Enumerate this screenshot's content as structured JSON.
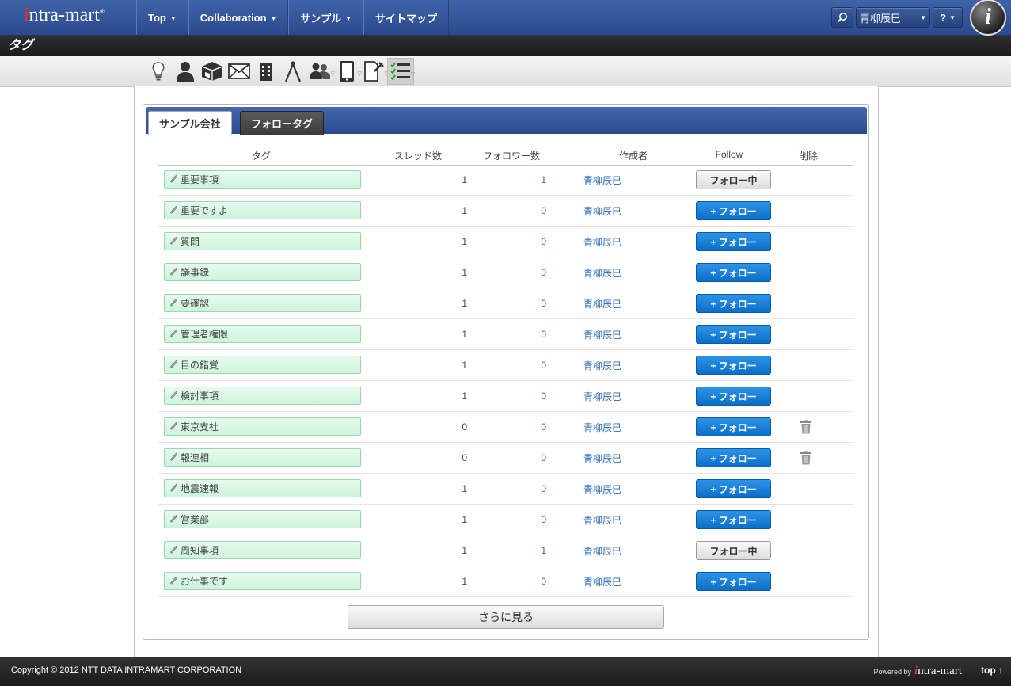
{
  "header": {
    "logo_i": "i",
    "logo_rest": "ntra-mart",
    "nav": [
      {
        "label": "Top",
        "caret": "▼"
      },
      {
        "label": "Collaboration",
        "caret": "▼"
      },
      {
        "label": "サンプル",
        "caret": "▼"
      },
      {
        "label": "サイトマップ",
        "caret": ""
      }
    ],
    "user_name": "青柳辰巳",
    "user_caret": "▼",
    "help_label": "?",
    "help_caret": "▼",
    "avatar_letter": "i"
  },
  "page_title": "タグ",
  "toolbar_icons": [
    "lightbulb-icon",
    "person-icon",
    "cube-icon",
    "mail-icon",
    "building-icon",
    "compass-icon",
    "group-icon",
    "tablet-icon",
    "document-pin-icon",
    "checklist-icon"
  ],
  "tabs": [
    {
      "label": "サンプル会社",
      "active": true
    },
    {
      "label": "フォロータグ",
      "active": false
    }
  ],
  "table": {
    "headers": {
      "tag": "タグ",
      "threads": "スレッド数",
      "followers": "フォロワー数",
      "creator": "作成者",
      "follow": "Follow",
      "delete": "削除"
    },
    "rows": [
      {
        "tag": "重要事項",
        "threads": "1",
        "followers": "1",
        "creator": "青柳辰巳",
        "follow": "フォロー中",
        "following": true,
        "deletable": false
      },
      {
        "tag": "重要ですよ",
        "threads": "1",
        "followers": "0",
        "creator": "青柳辰巳",
        "follow": "+ フォロー",
        "following": false,
        "deletable": false
      },
      {
        "tag": "質問",
        "threads": "1",
        "followers": "0",
        "creator": "青柳辰巳",
        "follow": "+ フォロー",
        "following": false,
        "deletable": false
      },
      {
        "tag": "議事録",
        "threads": "1",
        "followers": "0",
        "creator": "青柳辰巳",
        "follow": "+ フォロー",
        "following": false,
        "deletable": false
      },
      {
        "tag": "要確認",
        "threads": "1",
        "followers": "0",
        "creator": "青柳辰巳",
        "follow": "+ フォロー",
        "following": false,
        "deletable": false
      },
      {
        "tag": "管理者権限",
        "threads": "1",
        "followers": "0",
        "creator": "青柳辰巳",
        "follow": "+ フォロー",
        "following": false,
        "deletable": false
      },
      {
        "tag": "目の錯覚",
        "threads": "1",
        "followers": "0",
        "creator": "青柳辰巳",
        "follow": "+ フォロー",
        "following": false,
        "deletable": false
      },
      {
        "tag": "検討事項",
        "threads": "1",
        "followers": "0",
        "creator": "青柳辰巳",
        "follow": "+ フォロー",
        "following": false,
        "deletable": false
      },
      {
        "tag": "東京支社",
        "threads": "0",
        "followers": "0",
        "creator": "青柳辰巳",
        "follow": "+ フォロー",
        "following": false,
        "deletable": true
      },
      {
        "tag": "報連相",
        "threads": "0",
        "followers": "0",
        "creator": "青柳辰巳",
        "follow": "+ フォロー",
        "following": false,
        "deletable": true
      },
      {
        "tag": "地震速報",
        "threads": "1",
        "followers": "0",
        "creator": "青柳辰巳",
        "follow": "+ フォロー",
        "following": false,
        "deletable": false
      },
      {
        "tag": "営業部",
        "threads": "1",
        "followers": "0",
        "creator": "青柳辰巳",
        "follow": "+ フォロー",
        "following": false,
        "deletable": false
      },
      {
        "tag": "周知事項",
        "threads": "1",
        "followers": "1",
        "creator": "青柳辰巳",
        "follow": "フォロー中",
        "following": true,
        "deletable": false
      },
      {
        "tag": "お仕事です",
        "threads": "1",
        "followers": "0",
        "creator": "青柳辰巳",
        "follow": "+ フォロー",
        "following": false,
        "deletable": false
      }
    ]
  },
  "more_label": "さらに見る",
  "footer": {
    "copyright": "Copyright © 2012 NTT DATA INTRAMART CORPORATION",
    "powered_by": "Powered by",
    "powered_logo_i": "i",
    "powered_logo_rest": "ntra-mart",
    "top_label": "top ↑"
  },
  "colors": {
    "nav_blue": "#2b4a8c",
    "follow_blue": "#0b6fc9",
    "tag_green": "#cdf4dc",
    "link_blue": "#2a6ab8"
  }
}
